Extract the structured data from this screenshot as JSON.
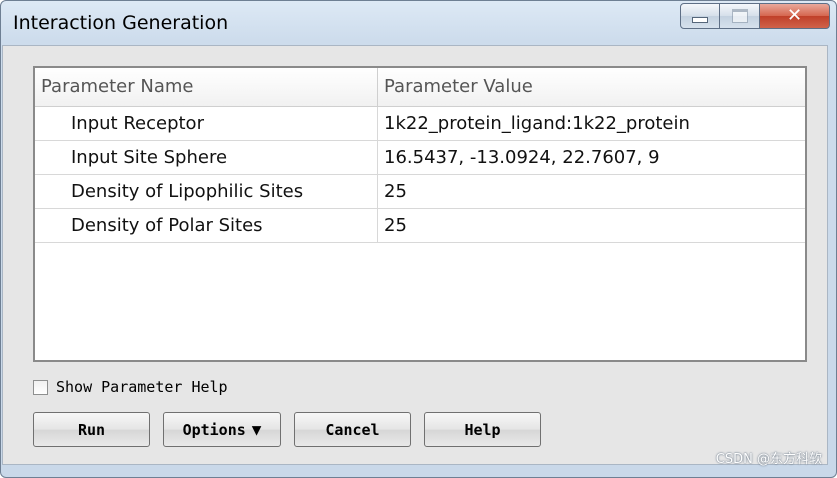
{
  "window": {
    "title": "Interaction Generation",
    "controls": {
      "minimize_icon": "minimize-icon",
      "maximize_icon": "maximize-icon",
      "close_icon": "close-icon",
      "close_glyph": "✕"
    }
  },
  "table": {
    "columns": [
      "Parameter Name",
      "Parameter Value"
    ],
    "rows": [
      {
        "name": "Input Receptor",
        "value": "1k22_protein_ligand:1k22_protein"
      },
      {
        "name": "Input Site Sphere",
        "value": "16.5437, -13.0924, 22.7607, 9"
      },
      {
        "name": "Density of Lipophilic Sites",
        "value": "25"
      },
      {
        "name": "Density of Polar Sites",
        "value": "25"
      }
    ]
  },
  "show_help": {
    "label": "Show Parameter Help",
    "checked": false
  },
  "buttons": {
    "run": "Run",
    "options": "Options",
    "options_arrow": "▼",
    "cancel": "Cancel",
    "help": "Help"
  },
  "watermark": "CSDN @东方科软",
  "colors": {
    "titlebar": "#cddcec",
    "close_button": "#c94f36",
    "panel": "#e6e6e6"
  }
}
